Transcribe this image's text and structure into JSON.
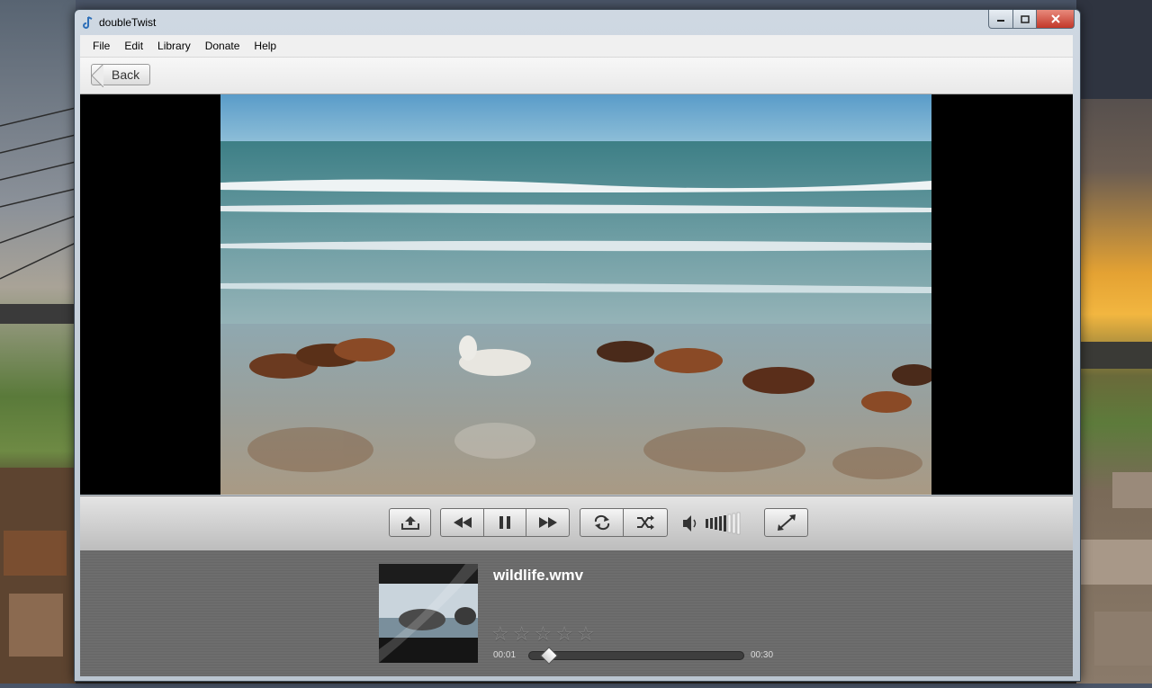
{
  "window": {
    "title": "doubleTwist"
  },
  "menu": {
    "items": [
      "File",
      "Edit",
      "Library",
      "Donate",
      "Help"
    ]
  },
  "toolbar": {
    "back_label": "Back"
  },
  "player": {
    "filename": "wildlife.wmv",
    "current_time": "00:01",
    "total_time": "00:30",
    "progress": 0.033,
    "rating": 0,
    "max_rating": 5,
    "volume_bars": 5,
    "state": "playing"
  },
  "icons": {
    "upload": "upload-icon",
    "rewind": "rewind-icon",
    "pause": "pause-icon",
    "forward": "fast-forward-icon",
    "repeat": "repeat-icon",
    "shuffle": "shuffle-icon",
    "volume": "volume-icon",
    "fullscreen": "fullscreen-icon"
  }
}
